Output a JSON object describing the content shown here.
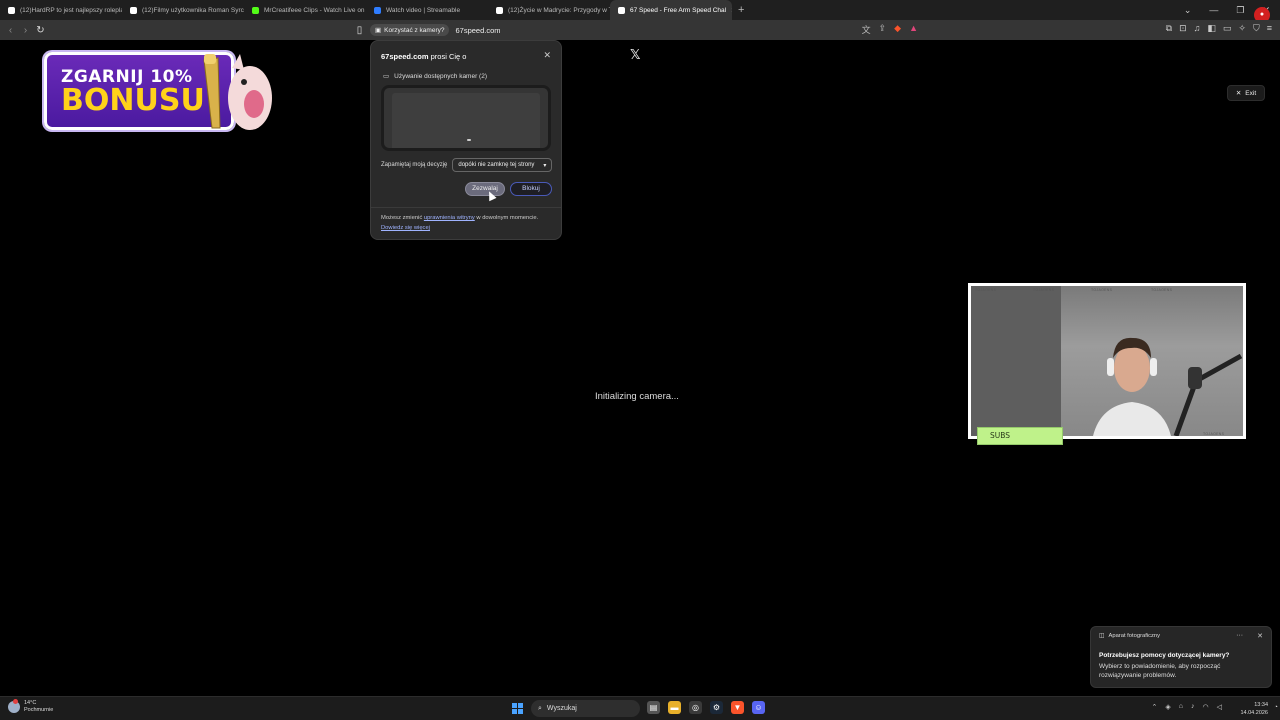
{
  "tabs": [
    {
      "label": "(12)HardRP to jest najlepszy roleplay",
      "icon": "tiktok-icon",
      "color": "#ffffff"
    },
    {
      "label": "(12)Filmy użytkownika Roman Syrcin",
      "icon": "tiktok-icon",
      "color": "#ffffff"
    },
    {
      "label": "MrCreatifeee Clips - Watch Live on K",
      "icon": "kick-icon",
      "color": "#53fc18"
    },
    {
      "label": "Watch video | Streamable",
      "icon": "streamable-icon",
      "color": "#2f7dff"
    },
    {
      "label": "(12)Życie w Madrycie: Przygody w Tr",
      "icon": "tiktok-icon",
      "color": "#ffffff"
    },
    {
      "label": "67 Speed - Free Arm Speed Chal",
      "icon": "67-icon",
      "color": "#ffffff",
      "active": true
    }
  ],
  "address": {
    "permission_chip": "Korzystać z kamery?",
    "url": "67speed.com"
  },
  "banner": {
    "line1": "ZGARNIJ 10%",
    "line2": "BONUSU"
  },
  "page": {
    "exit_label": "Exit",
    "status_text": "Initializing camera..."
  },
  "popup": {
    "site": "67speed.com",
    "title_suffix": "prosi Cię o",
    "camera_label": "Używanie dostępnych kamer (2)",
    "remember_label": "Zapamiętaj moją decyzję",
    "remember_value": "dopóki nie zamknę tej strony",
    "allow_label": "Zezwalaj",
    "block_label": "Blokuj",
    "footer_prefix": "Możesz zmienić",
    "footer_link": "uprawnienia witryny",
    "footer_suffix": "w dowolnym momencie.",
    "learn_more": "Dowiedz się więcej"
  },
  "overlay": {
    "subs_label": "SUBS",
    "watermark": "TOJAOENS"
  },
  "notification": {
    "app": "Aparat fotograficzny",
    "title": "Potrzebujesz pomocy dotyczącej kamery?",
    "body": "Wybierz to powiadomienie, aby rozpocząć rozwiązywanie problemów."
  },
  "taskbar": {
    "temperature": "14°C",
    "weather": "Pochmurnie",
    "search_placeholder": "Wyszukaj",
    "time": "13:34",
    "date": "14.04.2026"
  },
  "colors": {
    "tab_bar": "#1f1f1f",
    "toolbar": "#353535",
    "popup_bg": "#2a2a2a",
    "banner_purple": "#5a22b0",
    "banner_yellow": "#ffd21a",
    "subs_green": "#bff28a"
  }
}
